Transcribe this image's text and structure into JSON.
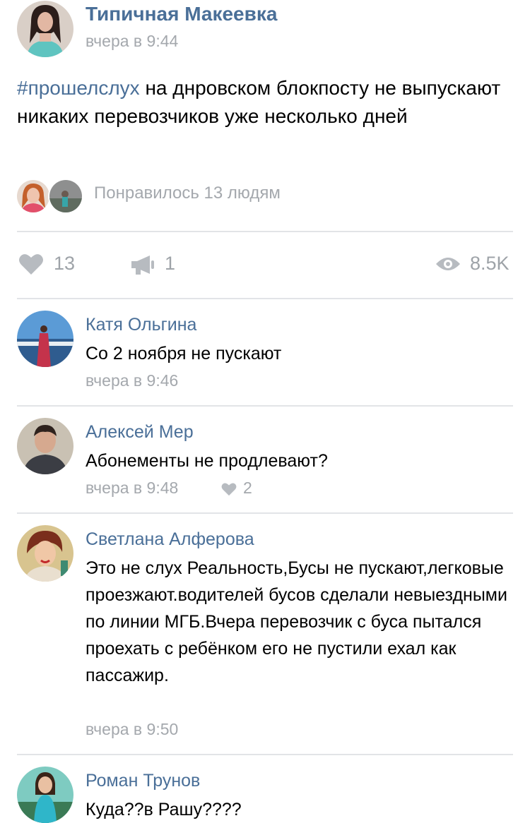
{
  "post": {
    "author": "Типичная Макеевка",
    "time": "вчера в 9:44",
    "hashtag": "#прошелслух",
    "text": " на днровском блокпосту не выпускают никаких перевозчиков уже несколько дней",
    "liked_by": "Понравилось 13 людям",
    "actions": {
      "likes": "13",
      "reposts": "1",
      "views": "8.5K"
    }
  },
  "comments": [
    {
      "author": "Катя Ольгина",
      "text": "Со 2 ноября не пускают",
      "time": "вчера в 9:46",
      "likes": ""
    },
    {
      "author": "Алексей Мер",
      "text": "Абонементы не продлевают?",
      "time": "вчера в 9:48",
      "likes": "2"
    },
    {
      "author": "Светлана Алферова",
      "text": "Это не слух Реальность,Бусы не пускают,легковые проезжают.водителей бусов сделали невыездными по линии МГБ.Вчера перевозчик с буса пытался проехать с ребёнком его не пустили ехал как пассажир.",
      "time": "вчера в 9:50",
      "likes": ""
    },
    {
      "author": "Роман Трунов",
      "text": "Куда??в Рашу????",
      "time": "",
      "likes": ""
    }
  ],
  "colors": {
    "link": "#4a6f98",
    "muted": "#a4a8ad",
    "divider": "#e2e4e7",
    "icon": "#b7bbc0"
  },
  "icons": {
    "like": "heart-icon",
    "repost": "megaphone-icon",
    "views": "eye-icon"
  }
}
